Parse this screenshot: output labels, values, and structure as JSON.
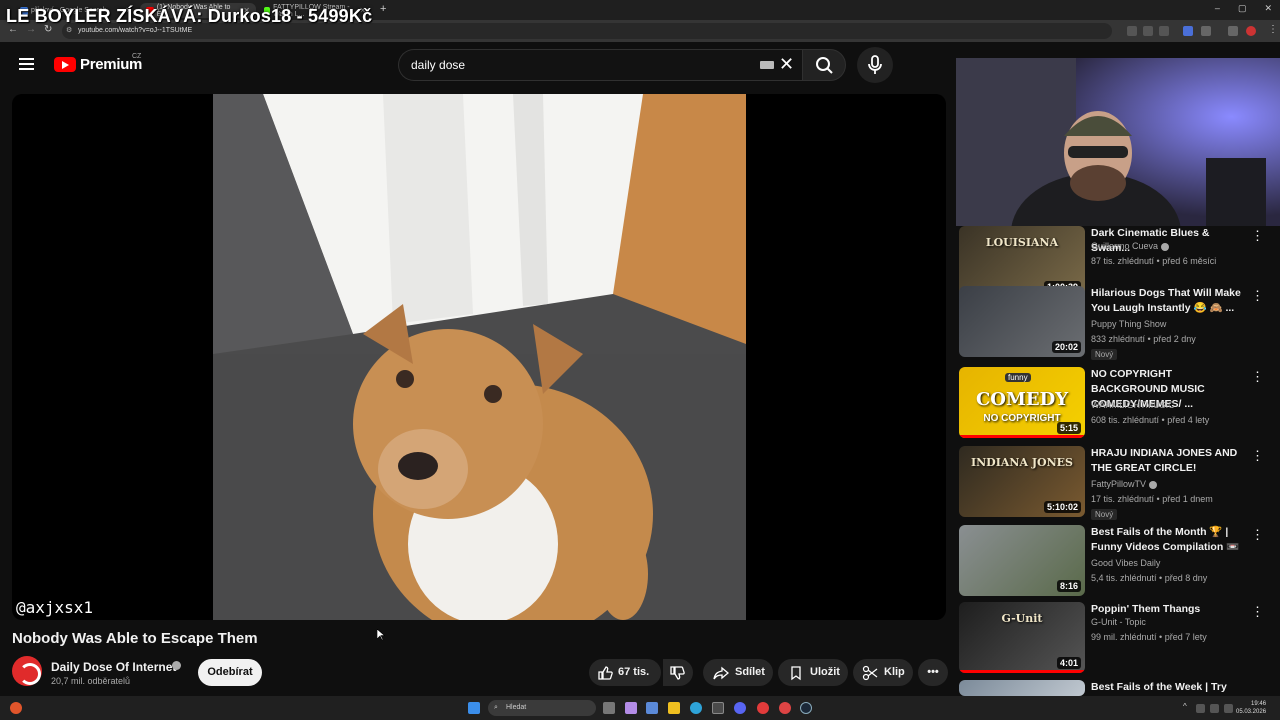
{
  "overlay": {
    "donation_text": "LE BOYLER ZÍSKÁVÁ: Durkos18 - 5499Kč"
  },
  "browser": {
    "tabs": [
      {
        "label": "přísloví - Google Search",
        "active": false
      },
      {
        "label": "(1) Nobody Was Able to E...",
        "active": true
      },
      {
        "label": "FATTYPILLOW Stream - Watch L...",
        "active": false
      }
    ],
    "url": "youtube.com/watch?v=oJ--1TSUtME",
    "window_controls": [
      "–",
      "▢",
      "✕"
    ]
  },
  "youtube": {
    "logo_text": "Premium",
    "region": "CZ",
    "search_value": "daily dose",
    "video": {
      "title": "Nobody Was Able to Escape Them",
      "watermark": "@axjxsx1",
      "channel_name": "Daily Dose Of Internet",
      "subscribers": "20,7 mil. odběratelů",
      "subscribe_label": "Odebírat",
      "likes": "67 tis.",
      "share_label": "Sdílet",
      "save_label": "Uložit",
      "clip_label": "Klip"
    },
    "recommendations": [
      {
        "title": "Dark Cinematic Blues & Swam...",
        "channel": "Guillermo Cueva",
        "verified": true,
        "meta": "87 tis. zhlédnutí • před 6 měsíci",
        "duration": "1:00:39",
        "badge": "",
        "thumb_text": "LOUISIANA",
        "progress": 1.0,
        "colors": [
          "#3a3326",
          "#7a6a48"
        ]
      },
      {
        "title": "Hilarious Dogs That Will Make You Laugh Instantly 😂 🙈 ...",
        "channel": "Puppy Thing Show",
        "verified": false,
        "meta": "833 zhlédnutí • před 2 dny",
        "duration": "20:02",
        "badge": "Nový",
        "thumb_text": "",
        "progress": 0,
        "colors": [
          "#3b3f46",
          "#6b6e72"
        ]
      },
      {
        "title": "NO COPYRIGHT BACKGROUND MUSIC COMEDY/MEMES/ ...",
        "channel": "WARMLIGHTMUSIC",
        "verified": false,
        "meta": "608 tis. zhlédnutí • před 4 lety",
        "duration": "5:15",
        "badge": "",
        "thumb_text": "COMEDY",
        "thumb_sub": "NO COPYRIGHT",
        "thumb_top": "funny",
        "progress": 1.0,
        "colors": [
          "#e6b400",
          "#f5d000"
        ]
      },
      {
        "title": "HRAJU INDIANA JONES AND THE GREAT CIRCLE!",
        "channel": "FattyPillowTV",
        "verified": true,
        "meta": "17 tis. zhlédnutí • před 1 dnem",
        "duration": "5:10:02",
        "badge": "Nový",
        "thumb_text": "INDIANA JONES",
        "progress": 0,
        "colors": [
          "#2f2a20",
          "#7a5a30"
        ]
      },
      {
        "title": "Best Fails of the Month 🏆 | Funny Videos Compilation 📼",
        "channel": "Good Vibes Daily",
        "verified": false,
        "meta": "5,4 tis. zhlédnutí • před 8 dny",
        "duration": "8:16",
        "badge": "",
        "thumb_text": "",
        "progress": 0,
        "colors": [
          "#8a8f92",
          "#5a6a4a"
        ]
      },
      {
        "title": "Poppin' Them Thangs",
        "channel": "G-Unit - Topic",
        "verified": false,
        "meta": "99 mil. zhlédnutí • před 7 lety",
        "duration": "4:01",
        "badge": "",
        "thumb_text": "G-Unit",
        "progress": 1.0,
        "colors": [
          "#1e1e1e",
          "#555"
        ]
      },
      {
        "title": "Best Fails of the Week | Try Not",
        "channel": "",
        "verified": false,
        "meta": "",
        "duration": "",
        "badge": "",
        "thumb_text": "",
        "progress": 0,
        "colors": [
          "#7b8a99",
          "#c0c8d0"
        ]
      }
    ]
  },
  "taskbar": {
    "search_placeholder": "Hledat",
    "time": "19:46",
    "date": "05.03.2026"
  },
  "colors": {
    "accent": "#ff0000",
    "background": "#0f0f0f",
    "pill": "#272727"
  }
}
